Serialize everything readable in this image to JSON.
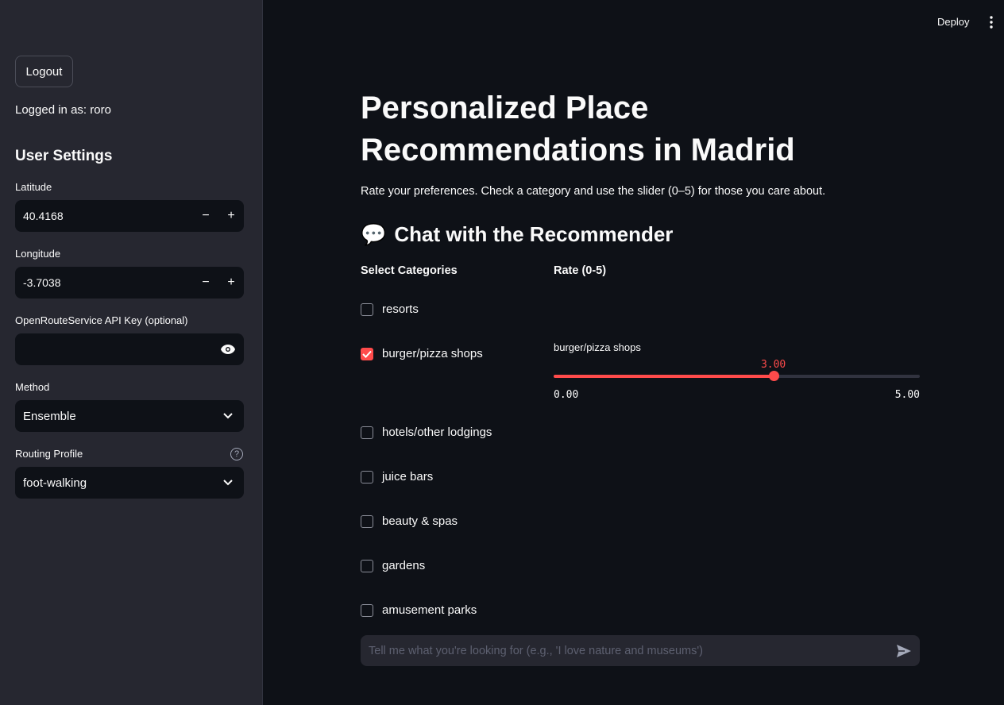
{
  "topbar": {
    "deploy_label": "Deploy"
  },
  "sidebar": {
    "logout_label": "Logout",
    "logged_in_text": "Logged in as: roro",
    "settings_title": "User Settings",
    "latitude": {
      "label": "Latitude",
      "value": "40.4168"
    },
    "longitude": {
      "label": "Longitude",
      "value": "-3.7038"
    },
    "api_key": {
      "label": "OpenRouteService API Key (optional)",
      "value": ""
    },
    "method": {
      "label": "Method",
      "value": "Ensemble"
    },
    "routing": {
      "label": "Routing Profile",
      "value": "foot-walking"
    }
  },
  "main": {
    "title": "Personalized Place Recommendations in Madrid",
    "intro": "Rate your preferences. Check a category and use the slider (0–5) for those you care about.",
    "chat_heading_icon": "💬",
    "chat_heading": "Chat with the Recommender",
    "col_categories": "Select Categories",
    "col_rate": "Rate (0-5)",
    "categories": [
      {
        "label": "resorts",
        "checked": false
      },
      {
        "label": "burger/pizza shops",
        "checked": true
      },
      {
        "label": "hotels/other lodgings",
        "checked": false
      },
      {
        "label": "juice bars",
        "checked": false
      },
      {
        "label": "beauty & spas",
        "checked": false
      },
      {
        "label": "gardens",
        "checked": false
      },
      {
        "label": "amusement parks",
        "checked": false
      }
    ],
    "slider": {
      "label": "burger/pizza shops",
      "value": 3.0,
      "value_text": "3.00",
      "min": 0,
      "max": 5,
      "min_text": "0.00",
      "max_text": "5.00"
    },
    "chat_placeholder": "Tell me what you're looking for (e.g., 'I love nature and museums')"
  },
  "colors": {
    "accent": "#ff4b4b",
    "background": "#0e1117",
    "sidebar": "#262730"
  }
}
